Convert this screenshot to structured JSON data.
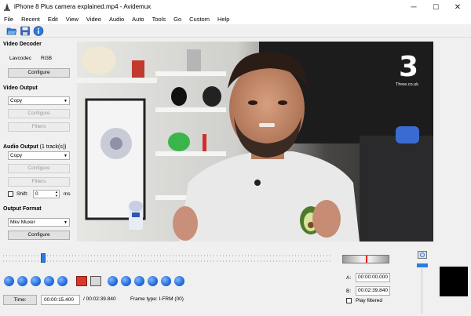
{
  "window": {
    "title": "iPhone 8 Plus camera explained.mp4 - Avidemux",
    "minimize_glyph": "─",
    "maximize_glyph": "☐",
    "close_glyph": "✕"
  },
  "menu": [
    "File",
    "Recent",
    "Edit",
    "View",
    "Video",
    "Audio",
    "Auto",
    "Tools",
    "Go",
    "Custom",
    "Help"
  ],
  "toolbar": {
    "icons": [
      "open-folder-icon",
      "save-disk-icon",
      "info-icon"
    ]
  },
  "video_decoder": {
    "title": "Video Decoder",
    "codec_label": "Lavcodec",
    "format": "RGB",
    "configure_label": "Configure"
  },
  "video_output": {
    "title": "Video Output",
    "selected": "Copy",
    "configure_label": "Configure",
    "filters_label": "Filters"
  },
  "audio_output": {
    "title": "Audio Output",
    "tracks": "(1 track(s))",
    "selected": "Copy",
    "configure_label": "Configure",
    "filters_label": "Filters",
    "shift_label": "Shift:",
    "shift_value": "0",
    "shift_unit": "ms"
  },
  "output_format": {
    "title": "Output Format",
    "selected": "Mkv Muxer",
    "configure_label": "Configure"
  },
  "video_frame": {
    "watermark_text": "Three.co.uk"
  },
  "timeline": {
    "position": 0.13
  },
  "transport": {
    "icons": [
      "play-icon",
      "previous-frame-icon",
      "next-frame-icon",
      "back-one-second-icon",
      "forward-one-second-icon",
      "set-marker-a-icon",
      "set-marker-b-icon",
      "previous-black-frame-icon",
      "next-black-frame-icon",
      "first-frame-icon",
      "last-frame-icon",
      "previous-cut-icon",
      "next-cut-icon",
      "jump-back-icon",
      "jump-forward-icon"
    ]
  },
  "status": {
    "time_button": "Time:",
    "current_time": "00:00:15.400",
    "total_time": "/ 00:02:39.840",
    "frame_type": "Frame type: I-FRM (00)"
  },
  "markers": {
    "a_label": "A:",
    "a_value": "00:00:00.000",
    "b_label": "B:",
    "b_value": "00:02:39.840",
    "play_filtered_label": "Play filtered"
  },
  "colors": {
    "accent": "#1f66d6",
    "video_bg": "#5a5855"
  }
}
